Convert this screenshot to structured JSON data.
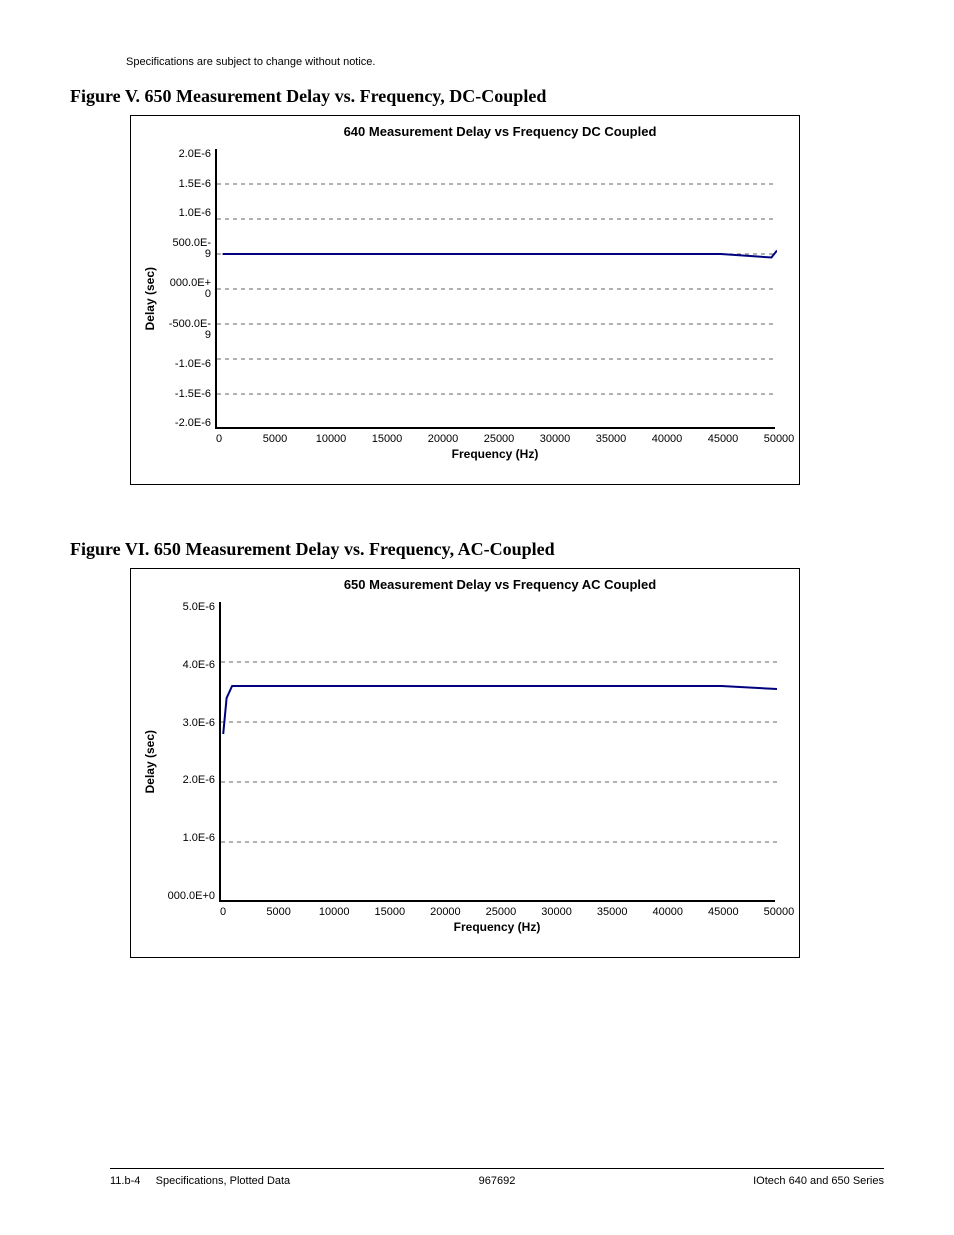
{
  "notice": "Specifications are subject to change without notice.",
  "figV": {
    "caption": "Figure V.  650 Measurement Delay vs. Frequency, DC-Coupled",
    "title": "640 Measurement Delay vs Frequency DC Coupled",
    "xlabel": "Frequency (Hz)",
    "ylabel": "Delay (sec)",
    "yticks": [
      "2.0E-6",
      "1.5E-6",
      "1.0E-6",
      "500.0E-\n9",
      "000.0E+\n0",
      "-500.0E-\n9",
      "-1.0E-6",
      "-1.5E-6",
      "-2.0E-6"
    ],
    "xticks": [
      "0",
      "5000",
      "10000",
      "15000",
      "20000",
      "25000",
      "30000",
      "35000",
      "40000",
      "45000",
      "50000"
    ]
  },
  "figVI": {
    "caption": "Figure VI.  650 Measurement Delay vs. Frequency, AC-Coupled",
    "title": "650 Measurement Delay vs Frequency AC Coupled",
    "xlabel": "Frequency (Hz)",
    "ylabel": "Delay (sec)",
    "yticks": [
      "5.0E-6",
      "4.0E-6",
      "3.0E-6",
      "2.0E-6",
      "1.0E-6",
      "000.0E+0"
    ],
    "xticks": [
      "0",
      "5000",
      "10000",
      "15000",
      "20000",
      "25000",
      "30000",
      "35000",
      "40000",
      "45000",
      "50000"
    ]
  },
  "footer": {
    "left_page": "11.b-4",
    "left_text": "Specifications, Plotted Data",
    "center": "967692",
    "right": "IOtech 640 and 650 Series"
  },
  "chart_data": [
    {
      "type": "line",
      "title": "640 Measurement Delay vs Frequency DC Coupled",
      "xlabel": "Frequency (Hz)",
      "ylabel": "Delay (sec)",
      "xlim": [
        0,
        50000
      ],
      "ylim": [
        -2e-06,
        2e-06
      ],
      "series": [
        {
          "name": "Delay",
          "x": [
            500,
            5000,
            10000,
            15000,
            20000,
            25000,
            30000,
            35000,
            40000,
            45000,
            49500,
            50000
          ],
          "y": [
            5e-07,
            5e-07,
            5e-07,
            5e-07,
            5e-07,
            5e-07,
            5e-07,
            5e-07,
            5e-07,
            5e-07,
            4.5e-07,
            5.5e-07
          ]
        }
      ],
      "grid": true
    },
    {
      "type": "line",
      "title": "650 Measurement Delay vs Frequency AC Coupled",
      "xlabel": "Frequency (Hz)",
      "ylabel": "Delay (sec)",
      "xlim": [
        0,
        50000
      ],
      "ylim": [
        0.0,
        5e-06
      ],
      "series": [
        {
          "name": "Delay",
          "x": [
            200,
            500,
            1000,
            5000,
            10000,
            15000,
            20000,
            25000,
            30000,
            35000,
            40000,
            45000,
            50000
          ],
          "y": [
            2.8e-06,
            3.4e-06,
            3.6e-06,
            3.6e-06,
            3.6e-06,
            3.6e-06,
            3.6e-06,
            3.6e-06,
            3.6e-06,
            3.6e-06,
            3.6e-06,
            3.6e-06,
            3.55e-06
          ]
        }
      ],
      "grid": true
    }
  ]
}
